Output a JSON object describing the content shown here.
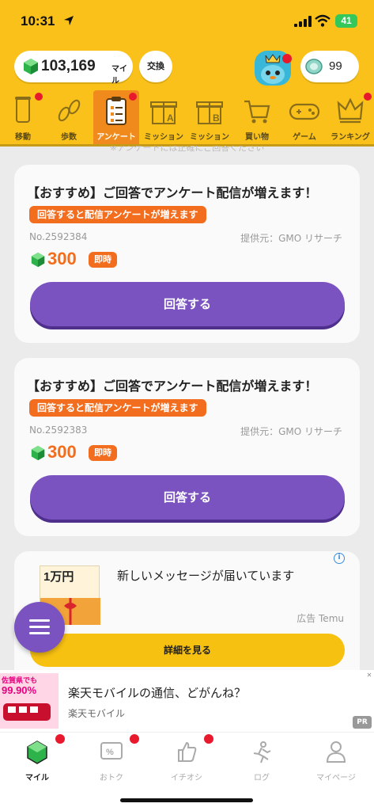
{
  "status_bar": {
    "time": "10:31",
    "battery": "41"
  },
  "header": {
    "miles": "103,169",
    "miles_unit": "マイル",
    "exchange_label": "交換",
    "coins": "99"
  },
  "categories": [
    {
      "label": "移動",
      "icon": "phone-tube-icon"
    },
    {
      "label": "歩数",
      "icon": "footprints-icon"
    },
    {
      "label": "アンケート",
      "icon": "clipboard-icon",
      "active": true
    },
    {
      "label": "ミッション",
      "icon": "gift-a-icon"
    },
    {
      "label": "ミッション",
      "icon": "gift-b-icon"
    },
    {
      "label": "買い物",
      "icon": "cart-icon"
    },
    {
      "label": "ゲーム",
      "icon": "gamepad-icon"
    },
    {
      "label": "ランキング",
      "icon": "crown-icon"
    }
  ],
  "notice": "※アンケートには正確にご回答ください",
  "surveys": [
    {
      "title": "【おすすめ】ご回答でアンケート配信が増えます！",
      "tag": "回答すると配信アンケートが増えます",
      "number": "No.2592384",
      "provider": "提供元：GMO リサーチ",
      "points": "300",
      "instant": "即時",
      "button": "回答する"
    },
    {
      "title": "【おすすめ】ご回答でアンケート配信が増えます！",
      "tag": "回答すると配信アンケートが増えます",
      "number": "No.2592383",
      "provider": "提供元：GMO リサーチ",
      "points": "300",
      "instant": "即時",
      "button": "回答する"
    }
  ],
  "ad": {
    "title": "新しいメッセージが届いています",
    "source": "広告 Temu",
    "button": "詳細を見る",
    "image_text": "1万円"
  },
  "banner": {
    "title": "楽天モバイルの通信、どがんね？",
    "subtitle": "楽天モバイル",
    "pr": "PR",
    "image_text_1": "佐賀県でも",
    "image_text_2": "99.90%"
  },
  "tabs": [
    {
      "label": "マイル",
      "icon": "gem-icon",
      "active": true
    },
    {
      "label": "おトク",
      "icon": "coupon-icon"
    },
    {
      "label": "イチオシ",
      "icon": "thumbs-up-icon"
    },
    {
      "label": "ログ",
      "icon": "runner-icon"
    },
    {
      "label": "マイページ",
      "icon": "person-icon"
    }
  ],
  "colors": {
    "header_yellow": "#f9c119",
    "accent_orange": "#f26d1d",
    "button_purple": "#7a53c1",
    "badge_red": "#e8192c"
  }
}
